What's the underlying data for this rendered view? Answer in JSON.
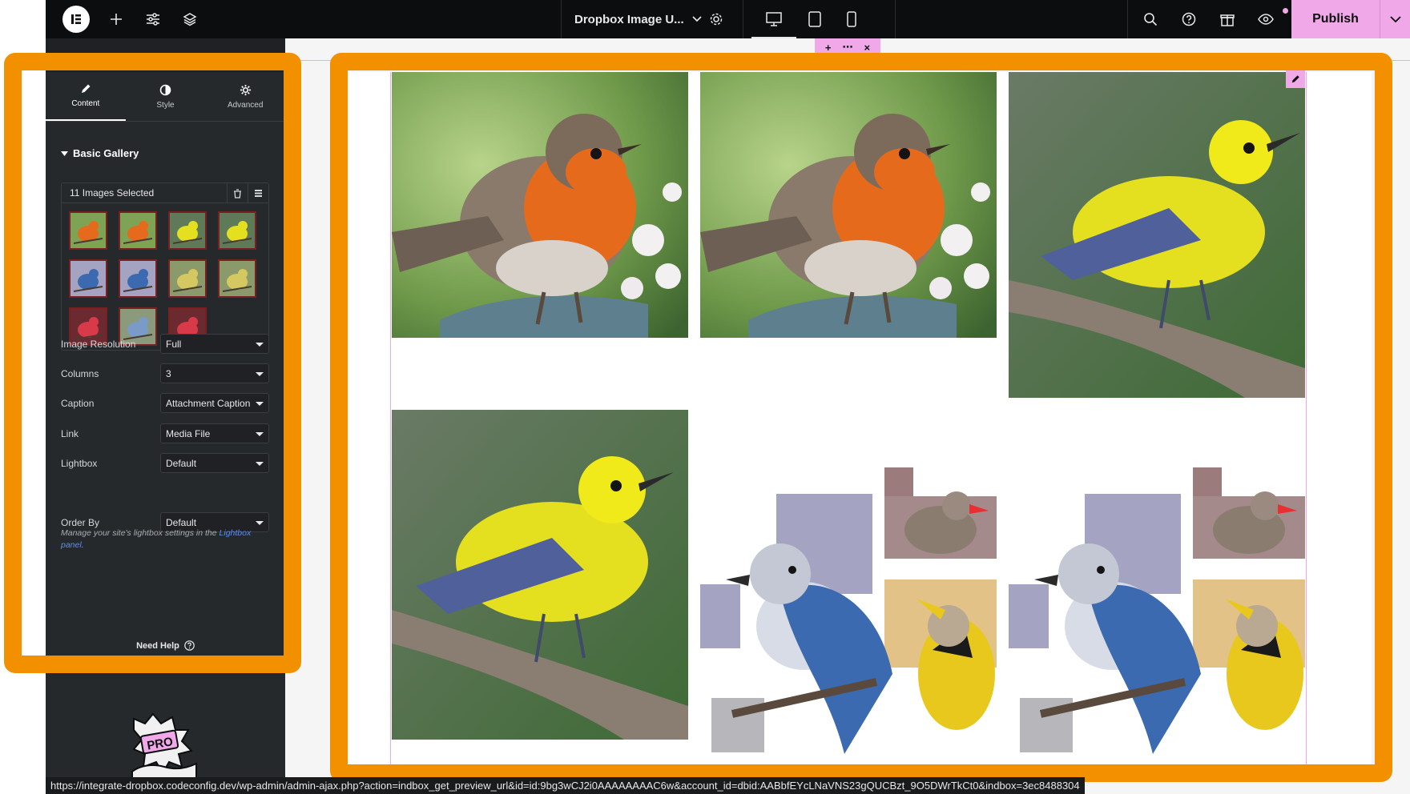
{
  "topbar": {
    "document_title": "Dropbox Image U...",
    "publish_label": "Publish",
    "icons": [
      "elementor-logo-icon",
      "add-icon",
      "sliders-icon",
      "layers-icon",
      "chevron-down-icon",
      "gear-icon",
      "desktop-icon",
      "tablet-icon",
      "mobile-icon",
      "search-icon",
      "help-icon",
      "gift-icon",
      "eye-icon",
      "chevron-down-icon"
    ],
    "accent_color": "#f0a8e8"
  },
  "panel": {
    "tabs": [
      {
        "label": "Content",
        "icon": "pencil-icon",
        "active": true
      },
      {
        "label": "Style",
        "icon": "half-circle-icon",
        "active": false
      },
      {
        "label": "Advanced",
        "icon": "gear-icon",
        "active": false
      }
    ],
    "section_title": "Basic Gallery",
    "gallery_count_label": "11 Images Selected",
    "thumbnail_count": 11,
    "controls": [
      {
        "label": "Image Resolution",
        "value": "Full"
      },
      {
        "label": "Columns",
        "value": "3"
      },
      {
        "label": "Caption",
        "value": "Attachment Caption"
      },
      {
        "label": "Link",
        "value": "Media File"
      },
      {
        "label": "Lightbox",
        "value": "Default"
      },
      {
        "label": "Order By",
        "value": "Default"
      }
    ],
    "lightbox_help_prefix": "Manage your site's lightbox settings in the ",
    "lightbox_help_link1": "Lightbox",
    "lightbox_help_link2": "panel",
    "lightbox_help_suffix": ".",
    "need_help": "Need Help",
    "pro_badge_text": "PRO"
  },
  "canvas": {
    "handle_add": "+",
    "handle_move": "⋯",
    "handle_close": "×"
  },
  "status_url": "https://integrate-dropbox.codeconfig.dev/wp-admin/admin-ajax.php?action=indbox_get_preview_url&id=id:9bg3wCJ2i0AAAAAAAAC6w&account_id=dbid:AABbfEYcLNaVNS23gQUCBzt_9O5DWrTkCt0&indbox=3ec8488304",
  "highlight_color": "#f39000"
}
